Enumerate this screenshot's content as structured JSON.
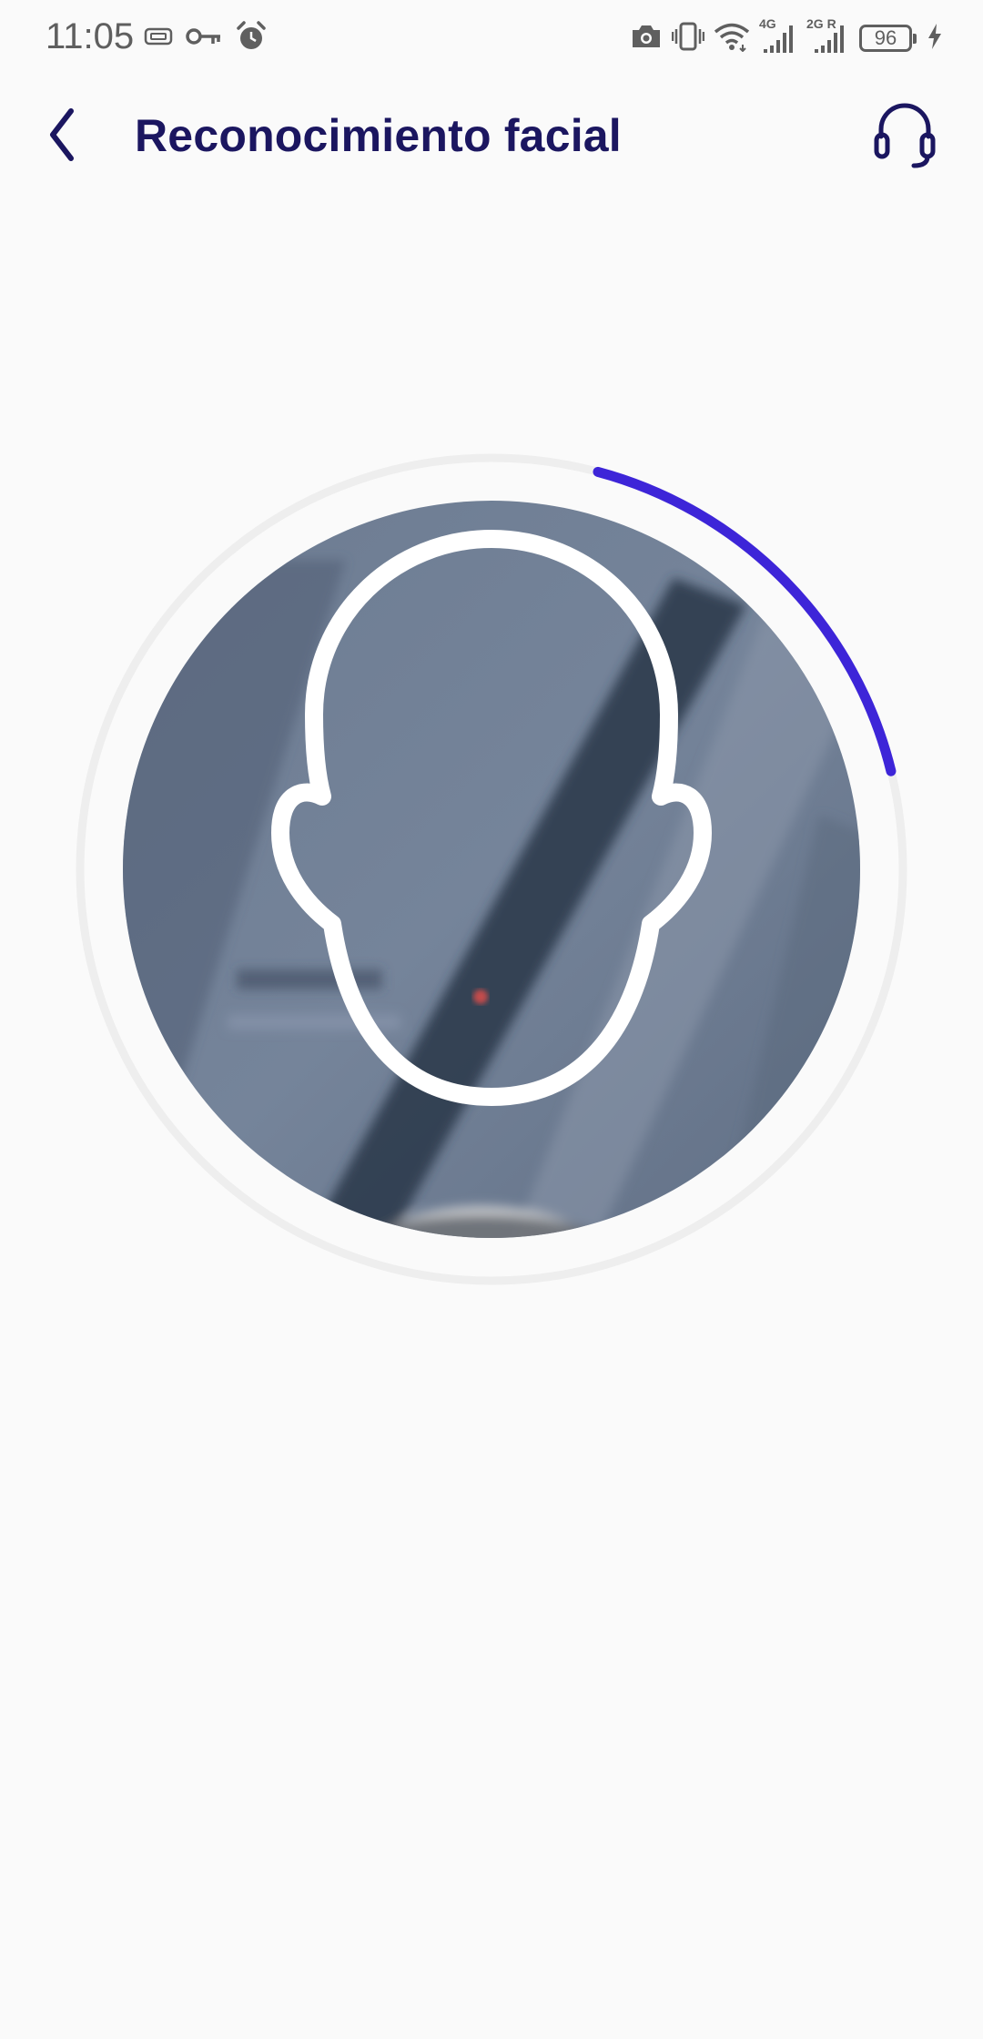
{
  "status_bar": {
    "time": "11:05",
    "left_icons": [
      "sim-card-icon",
      "vpn-key-icon",
      "alarm-icon"
    ],
    "right_icons": [
      "camera-in-use-icon",
      "vibrate-icon",
      "wifi-icon",
      "signal-4g-icon",
      "signal-2g-roaming-icon",
      "battery-icon",
      "charging-icon"
    ],
    "network_1": "4G",
    "network_2": "2G R",
    "battery_level": "96"
  },
  "app_bar": {
    "title": "Reconocimiento facial",
    "back_icon": "chevron-left-icon",
    "support_icon": "headset-icon"
  },
  "face_capture": {
    "progress_fraction": 0.17,
    "accent_color": "#3d25d8",
    "track_color": "#eeeeee",
    "guide_color": "#ffffff"
  },
  "colors": {
    "background": "#fafafa",
    "title": "#1b1660",
    "status": "#5f5f5f"
  }
}
